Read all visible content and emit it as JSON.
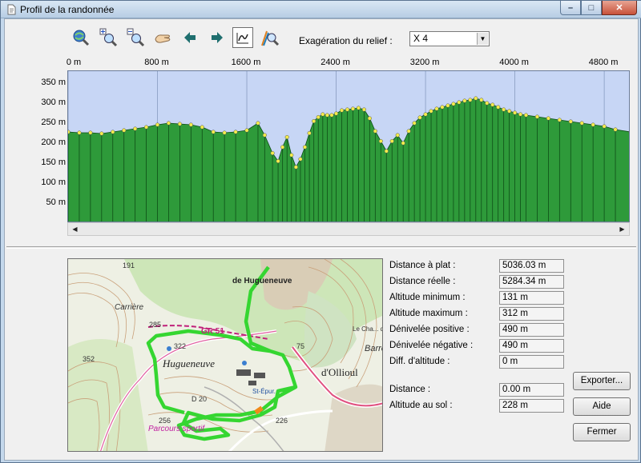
{
  "window": {
    "title": "Profil de la randonnée"
  },
  "toolbar": {
    "tools": [
      "zoom-globe-icon",
      "zoom-in-icon",
      "zoom-out-icon",
      "hand-pan-icon",
      "arrow-left-icon",
      "arrow-right-icon",
      "profile-select-icon",
      "locate-icon"
    ],
    "exaggeration_label": "Exagération du relief :",
    "exaggeration_value": "X 4"
  },
  "chart_data": {
    "type": "area",
    "title": "",
    "xlabel": "",
    "ylabel": "",
    "x_unit": "m",
    "y_unit": "m",
    "xlim": [
      0,
      5036
    ],
    "ylim": [
      0,
      380
    ],
    "xticks": [
      "0 m",
      "800 m",
      "1600 m",
      "2400 m",
      "3200 m",
      "4000 m",
      "4800 m"
    ],
    "xtick_values": [
      0,
      800,
      1600,
      2400,
      3200,
      4000,
      4800
    ],
    "yticks": [
      "350 m",
      "300 m",
      "250 m",
      "200 m",
      "150 m",
      "100 m",
      "50 m"
    ],
    "ytick_values": [
      350,
      300,
      250,
      200,
      150,
      100,
      50
    ],
    "series": [
      {
        "x": [
          0,
          100,
          200,
          300,
          400,
          500,
          600,
          700,
          800,
          900,
          1000,
          1100,
          1200,
          1300,
          1400,
          1500,
          1600,
          1700,
          1760,
          1830,
          1880,
          1920,
          1960,
          2000,
          2040,
          2080,
          2120,
          2160,
          2200,
          2240,
          2280,
          2320,
          2360,
          2400,
          2450,
          2500,
          2550,
          2600,
          2650,
          2700,
          2750,
          2800,
          2850,
          2900,
          2950,
          3000,
          3050,
          3100,
          3150,
          3200,
          3250,
          3300,
          3350,
          3400,
          3450,
          3500,
          3550,
          3600,
          3650,
          3700,
          3750,
          3800,
          3850,
          3900,
          3950,
          4000,
          4050,
          4100,
          4200,
          4300,
          4400,
          4500,
          4600,
          4700,
          4800,
          4900,
          5036
        ],
        "y": [
          228,
          226,
          226,
          224,
          228,
          232,
          236,
          240,
          246,
          250,
          248,
          246,
          240,
          228,
          226,
          228,
          232,
          250,
          220,
          175,
          155,
          190,
          215,
          170,
          140,
          160,
          190,
          225,
          255,
          265,
          272,
          270,
          270,
          274,
          282,
          284,
          286,
          288,
          284,
          262,
          230,
          205,
          180,
          205,
          220,
          200,
          230,
          250,
          264,
          272,
          280,
          286,
          290,
          294,
          298,
          302,
          306,
          308,
          312,
          308,
          300,
          296,
          290,
          284,
          280,
          276,
          272,
          270,
          266,
          262,
          258,
          254,
          250,
          246,
          242,
          234,
          228
        ]
      }
    ]
  },
  "map": {
    "labels": [
      "191",
      "Carrière",
      "de Hugueneuve",
      "285",
      "322",
      "GR 51",
      "Hugueneuve",
      "352",
      "75",
      "d'Ollioul",
      "St-Épur.",
      "D 20",
      "256",
      "226",
      "Parcours sportif",
      "Barre",
      "Le Cha... de Di..."
    ]
  },
  "stats": [
    {
      "label": "Distance à plat :",
      "value": "5036.03 m"
    },
    {
      "label": "Distance réelle :",
      "value": "5284.34 m"
    },
    {
      "label": "Altitude minimum :",
      "value": "131 m"
    },
    {
      "label": "Altitude maximum :",
      "value": "312 m"
    },
    {
      "label": "Dénivelée positive :",
      "value": "490 m"
    },
    {
      "label": "Dénivelée négative :",
      "value": "490 m"
    },
    {
      "label": "Diff. d'altitude :",
      "value": "0 m"
    }
  ],
  "cursor": [
    {
      "label": "Distance :",
      "value": "0.00 m"
    },
    {
      "label": "Altitude au sol :",
      "value": "228 m"
    }
  ],
  "buttons": {
    "export": "Exporter...",
    "help": "Aide",
    "close": "Fermer"
  },
  "colors": {
    "fill": "#2e9a3a",
    "plot_bg": "#c7d6f5",
    "point": "#f4ec4c",
    "track": "#35d631"
  }
}
